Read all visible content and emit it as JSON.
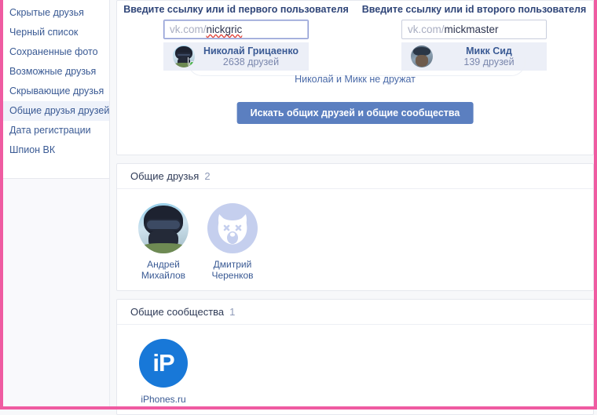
{
  "sidebar": {
    "items": [
      {
        "label": "Скрытые друзья",
        "active": false
      },
      {
        "label": "Черный список",
        "active": false
      },
      {
        "label": "Сохраненные фото",
        "active": false
      },
      {
        "label": "Возможные друзья",
        "active": false
      },
      {
        "label": "Скрывающие друзья",
        "active": false
      },
      {
        "label": "Общие друзья друзей",
        "active": true
      },
      {
        "label": "Дата регистрации",
        "active": false
      },
      {
        "label": "Шпион ВК",
        "active": false
      }
    ]
  },
  "form": {
    "first": {
      "label": "Введите ссылку или id первого пользователя",
      "prefix": "vk.com/",
      "value": "nickgric",
      "user_name": "Николай Грицаенко",
      "user_friends": "2638 друзей"
    },
    "second": {
      "label": "Введите ссылку или id второго пользователя",
      "prefix": "vk.com/",
      "value": "mickmaster",
      "user_name": "Микк Сид",
      "user_friends": "139 друзей"
    },
    "relation_status": "Николай и Микк не дружат",
    "search_button": "Искать общих друзей и общие сообщества"
  },
  "mutual_friends": {
    "title": "Общие друзья",
    "count": "2",
    "items": [
      {
        "name_line1": "Андрей",
        "name_line2": "Михайлов",
        "avatar": "photo"
      },
      {
        "name_line1": "Дмитрий",
        "name_line2": "Черенков",
        "avatar": "dog-placeholder-icon"
      }
    ]
  },
  "mutual_communities": {
    "title": "Общие сообщества",
    "count": "1",
    "items": [
      {
        "name": "iPhones.ru",
        "logo_text": "iP"
      }
    ]
  },
  "colors": {
    "accent_blue": "#5b7fc0",
    "link_blue": "#3a5a94",
    "page_border_pink": "#ef5ba1",
    "community_blue": "#1878d8",
    "online_green": "#4bb34b",
    "page_bg": "#f7f8fa"
  }
}
